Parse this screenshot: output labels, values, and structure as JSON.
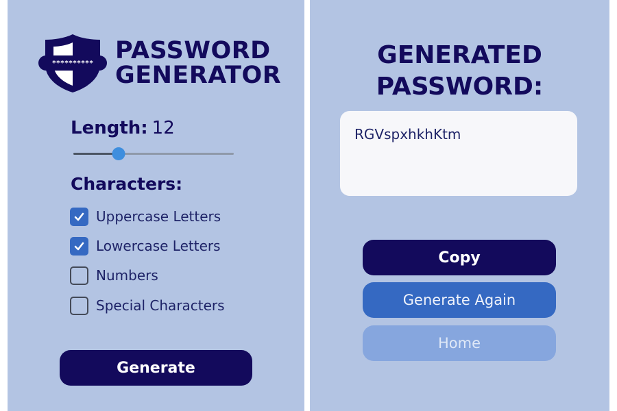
{
  "generator": {
    "title_line1": "PASSWORD",
    "title_line2": "GENERATOR",
    "logo_icon": "shield-icon",
    "logo_mask": "**********",
    "length_label": "Length:",
    "length_value": "12",
    "length_slider": {
      "min": 0,
      "max": 50,
      "value": 12
    },
    "characters_heading": "Characters:",
    "options": [
      {
        "label": "Uppercase Letters",
        "checked": true
      },
      {
        "label": "Lowercase Letters",
        "checked": true
      },
      {
        "label": "Numbers",
        "checked": false
      },
      {
        "label": "Special Characters",
        "checked": false
      }
    ],
    "generate_label": "Generate"
  },
  "result": {
    "title_line1": "GENERATED",
    "title_line2": "PASSWORD:",
    "password": "RGVspxhkhKtm",
    "copy_label": "Copy",
    "generate_again_label": "Generate Again",
    "home_label": "Home"
  },
  "colors": {
    "panel_bg": "#b3c4e3",
    "navy": "#130a5c",
    "accent_blue": "#3569c2",
    "slider_thumb": "#3e8ede",
    "home_disabled": "#86a6de"
  }
}
